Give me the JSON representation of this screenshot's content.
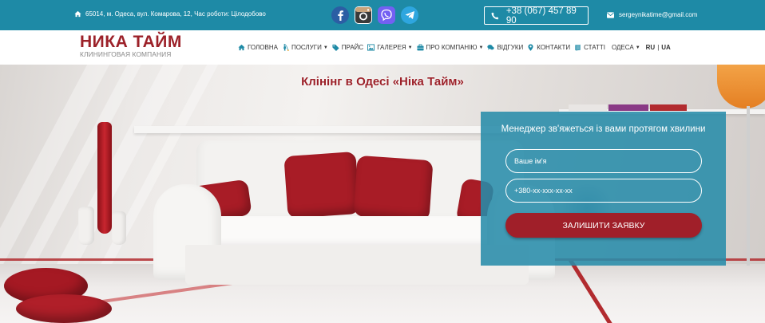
{
  "topbar": {
    "address": "65014, м. Одеса, вул. Комарова, 12, Час роботи: Цілодобово",
    "address_icon": "home-icon",
    "socials": [
      "facebook-icon",
      "instagram-icon",
      "viber-icon",
      "telegram-icon"
    ],
    "phone": "+38 (067) 457 89 90",
    "phone_icon": "phone-icon",
    "email": "sergeynikatime@gmail.com",
    "email_icon": "envelope-icon",
    "bg_color": "#1e8aa6"
  },
  "logo": {
    "brand": "НИКА ТАЙМ",
    "subtitle": "КЛИНИНГОВАЯ КОМПАНИЯ",
    "color": "#9c2129"
  },
  "nav": {
    "items": [
      {
        "label": "ГОЛОВНА",
        "icon": "home-icon",
        "dropdown": false
      },
      {
        "label": "ПОСЛУГИ",
        "icon": "cleaner-icon",
        "dropdown": true
      },
      {
        "label": "ПРАЙС",
        "icon": "tags-icon",
        "dropdown": false
      },
      {
        "label": "ГАЛЕРЕЯ",
        "icon": "picture-icon",
        "dropdown": true
      },
      {
        "label": "ПРО КОМПАНІЮ",
        "icon": "briefcase-icon",
        "dropdown": true
      },
      {
        "label": "ВІДГУКИ",
        "icon": "comments-icon",
        "dropdown": false
      },
      {
        "label": "КОНТАКТИ",
        "icon": "map-marker-icon",
        "dropdown": false
      },
      {
        "label": "СТАТТІ",
        "icon": "book-icon",
        "dropdown": false
      }
    ],
    "city": "ОДЕСА",
    "lang_ru": "RU",
    "lang_sep": "|",
    "lang_ua": "UA"
  },
  "hero": {
    "title": "Клінінг в Одесі «Ніка Тайм»",
    "accent_color": "#a01f29"
  },
  "form": {
    "title": "Менеджер зв'яжеться із вами протягом хвилини",
    "name_placeholder": "Ваше ім'я",
    "phone_placeholder": "+380-xx-xxx-xx-xx",
    "submit_label": "ЗАЛИШИТИ ЗАЯВКУ",
    "panel_color": "#288caa",
    "button_color": "#a01f29"
  }
}
